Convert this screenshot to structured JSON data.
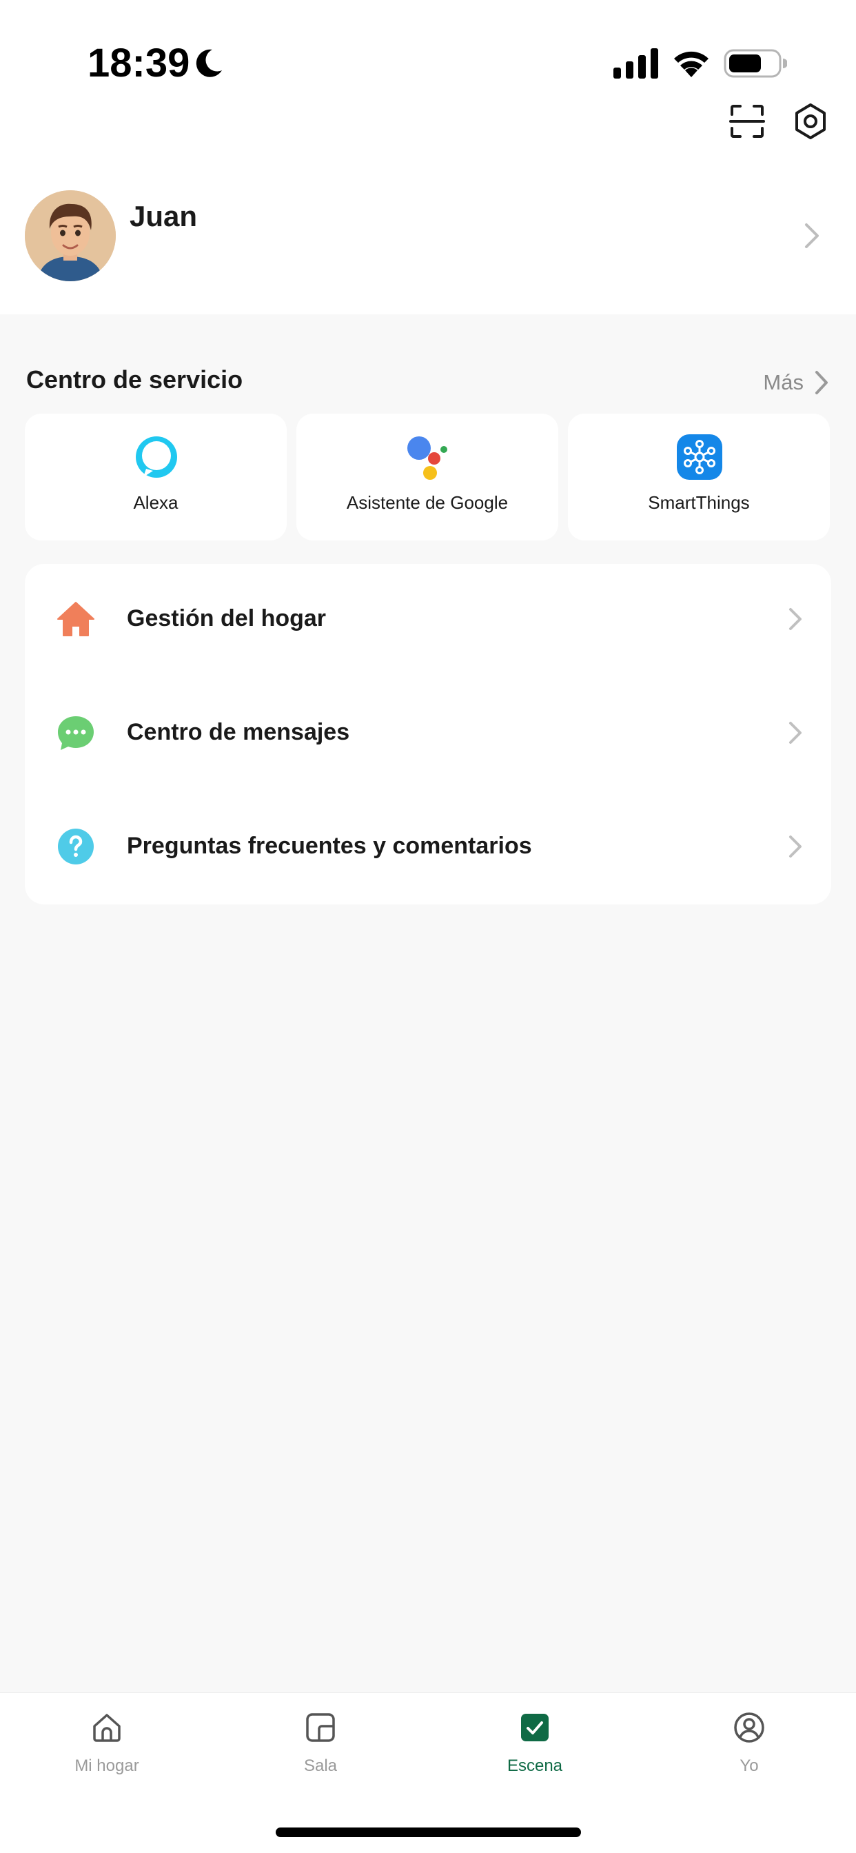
{
  "status_bar": {
    "time": "18:39",
    "icons": [
      "moon-icon",
      "signal-icon",
      "wifi-icon",
      "battery-icon"
    ]
  },
  "toolbar": {
    "icons": [
      "scan-icon",
      "settings-icon"
    ]
  },
  "profile": {
    "name": "Juan",
    "avatar": "avatar"
  },
  "service_center": {
    "title": "Centro de servicio",
    "more_label": "Más",
    "cards": [
      {
        "label": "Alexa",
        "icon": "alexa-icon"
      },
      {
        "label": "Asistente de Google",
        "icon": "google-assistant-icon"
      },
      {
        "label": "SmartThings",
        "icon": "smartthings-icon"
      }
    ]
  },
  "menu": {
    "items": [
      {
        "label": "Gestión del hogar",
        "icon": "home-management-icon",
        "color": "#f07f5a"
      },
      {
        "label": "Centro de mensajes",
        "icon": "message-icon",
        "color": "#6bce73"
      },
      {
        "label": "Preguntas frecuentes y comentarios",
        "icon": "help-icon",
        "color": "#4fcbe8"
      }
    ]
  },
  "bottom_nav": {
    "active": "Escena",
    "items": [
      {
        "label": "Mi hogar",
        "icon": "home-icon"
      },
      {
        "label": "Sala",
        "icon": "room-icon"
      },
      {
        "label": "Escena",
        "icon": "scene-icon"
      },
      {
        "label": "Yo",
        "icon": "profile-icon"
      }
    ]
  },
  "colors": {
    "accent": "#0f6a45",
    "background": "#f8f8f8",
    "card": "#ffffff",
    "muted_text": "#8a8a8a"
  }
}
